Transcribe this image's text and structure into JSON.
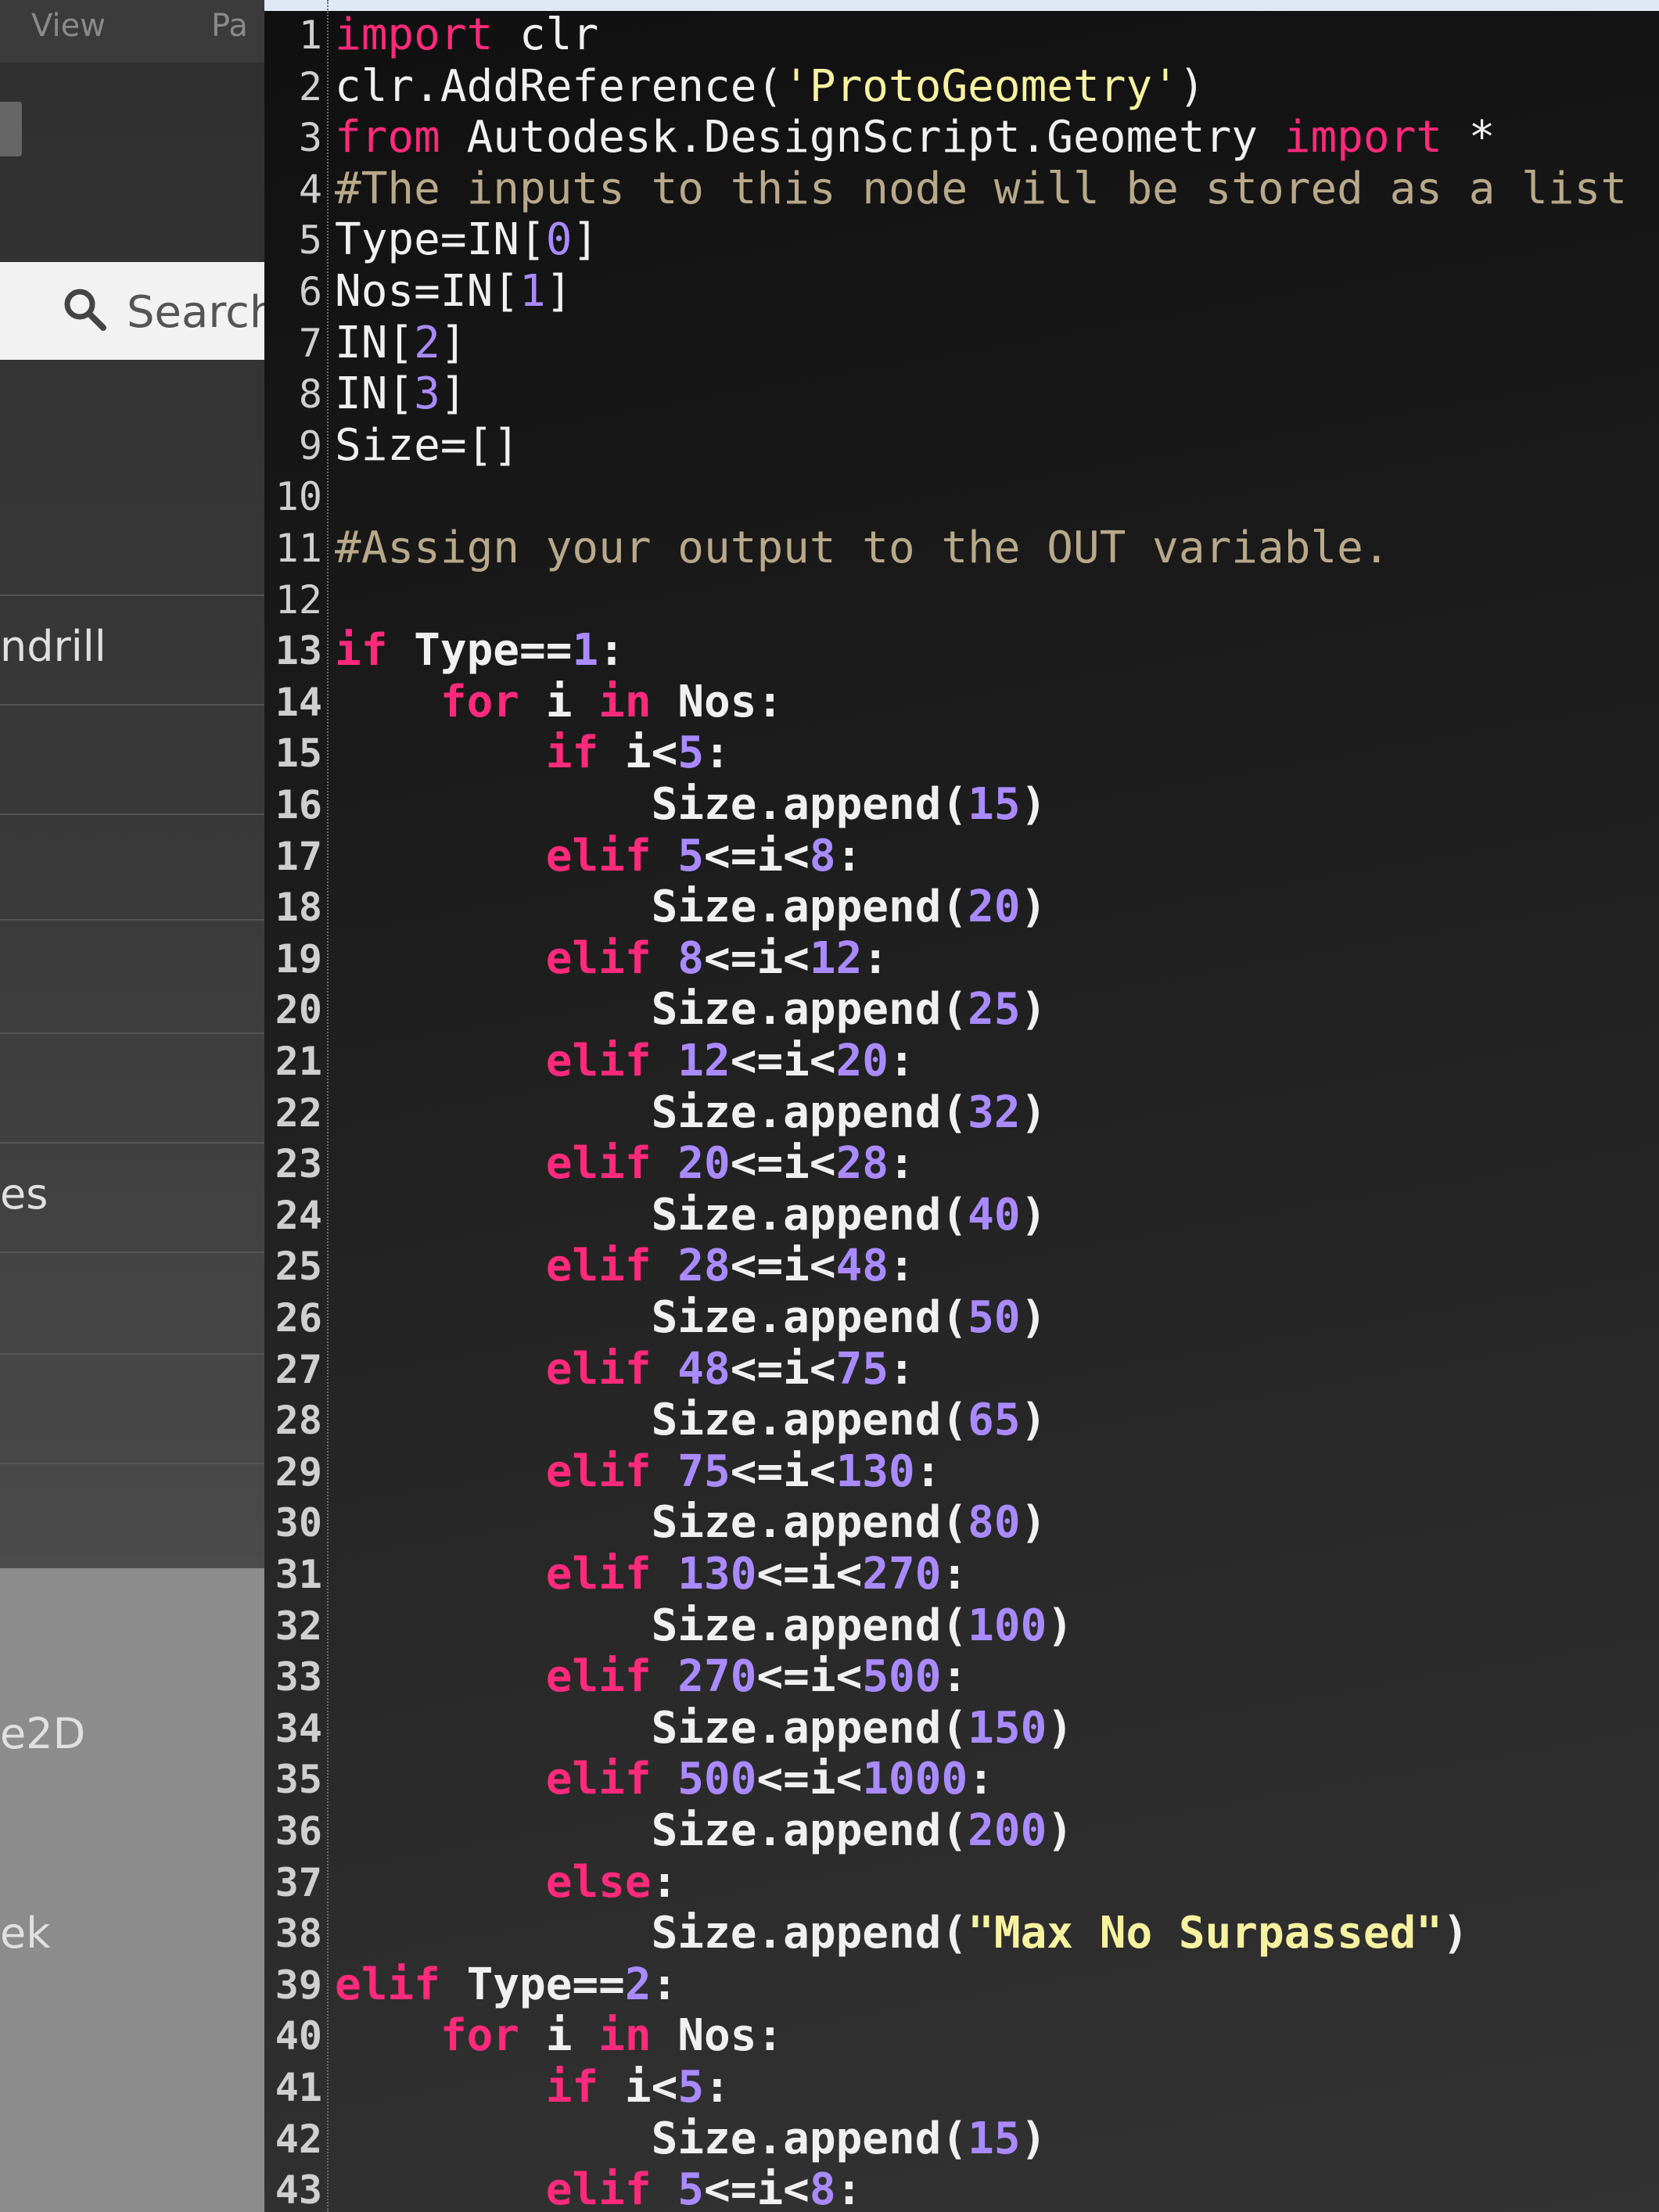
{
  "menu": {
    "view": "View",
    "partial": "Pa"
  },
  "library": {
    "search_label": "Search",
    "items": [
      "ndrill",
      "es",
      "e2D",
      "ek"
    ]
  },
  "editor": {
    "lines": [
      {
        "n": "1",
        "tokens": [
          [
            "kw",
            "import"
          ],
          [
            "op",
            " clr"
          ]
        ]
      },
      {
        "n": "2",
        "tokens": [
          [
            "op",
            "clr.AddReference("
          ],
          [
            "str",
            "'ProtoGeometry'"
          ],
          [
            "op",
            ")"
          ]
        ]
      },
      {
        "n": "3",
        "tokens": [
          [
            "kw",
            "from"
          ],
          [
            "op",
            " Autodesk.DesignScript.Geometry "
          ],
          [
            "kw",
            "import"
          ],
          [
            "op",
            " *"
          ]
        ]
      },
      {
        "n": "4",
        "tokens": [
          [
            "cmt",
            "#The inputs to this node will be stored as a list"
          ]
        ]
      },
      {
        "n": "5",
        "tokens": [
          [
            "op",
            "Type=IN["
          ],
          [
            "num",
            "0"
          ],
          [
            "op",
            "]"
          ]
        ]
      },
      {
        "n": "6",
        "tokens": [
          [
            "op",
            "Nos=IN["
          ],
          [
            "num",
            "1"
          ],
          [
            "op",
            "]"
          ]
        ]
      },
      {
        "n": "7",
        "tokens": [
          [
            "op",
            "IN["
          ],
          [
            "num",
            "2"
          ],
          [
            "op",
            "]"
          ]
        ]
      },
      {
        "n": "8",
        "tokens": [
          [
            "op",
            "IN["
          ],
          [
            "num",
            "3"
          ],
          [
            "op",
            "]"
          ]
        ]
      },
      {
        "n": "9",
        "tokens": [
          [
            "op",
            "Size=[]"
          ]
        ]
      },
      {
        "n": "10",
        "tokens": []
      },
      {
        "n": "11",
        "tokens": [
          [
            "cmt",
            "#Assign your output to the OUT variable."
          ]
        ]
      },
      {
        "n": "12",
        "tokens": []
      },
      {
        "n": "13",
        "tokens": [
          [
            "kw",
            "if"
          ],
          [
            "op",
            " Type=="
          ],
          [
            "num",
            "1"
          ],
          [
            "op",
            ":"
          ]
        ]
      },
      {
        "n": "14",
        "tokens": [
          [
            "op",
            "    "
          ],
          [
            "kw",
            "for"
          ],
          [
            "op",
            " i "
          ],
          [
            "kw",
            "in"
          ],
          [
            "op",
            " Nos:"
          ]
        ]
      },
      {
        "n": "15",
        "tokens": [
          [
            "op",
            "        "
          ],
          [
            "kw",
            "if"
          ],
          [
            "op",
            " i<"
          ],
          [
            "num",
            "5"
          ],
          [
            "op",
            ":"
          ]
        ]
      },
      {
        "n": "16",
        "tokens": [
          [
            "op",
            "            Size.append("
          ],
          [
            "num",
            "15"
          ],
          [
            "op",
            ")"
          ]
        ]
      },
      {
        "n": "17",
        "tokens": [
          [
            "op",
            "        "
          ],
          [
            "kw",
            "elif"
          ],
          [
            "op",
            " "
          ],
          [
            "num",
            "5"
          ],
          [
            "op",
            "<=i<"
          ],
          [
            "num",
            "8"
          ],
          [
            "op",
            ":"
          ]
        ]
      },
      {
        "n": "18",
        "tokens": [
          [
            "op",
            "            Size.append("
          ],
          [
            "num",
            "20"
          ],
          [
            "op",
            ")"
          ]
        ]
      },
      {
        "n": "19",
        "tokens": [
          [
            "op",
            "        "
          ],
          [
            "kw",
            "elif"
          ],
          [
            "op",
            " "
          ],
          [
            "num",
            "8"
          ],
          [
            "op",
            "<=i<"
          ],
          [
            "num",
            "12"
          ],
          [
            "op",
            ":"
          ]
        ]
      },
      {
        "n": "20",
        "tokens": [
          [
            "op",
            "            Size.append("
          ],
          [
            "num",
            "25"
          ],
          [
            "op",
            ")"
          ]
        ]
      },
      {
        "n": "21",
        "tokens": [
          [
            "op",
            "        "
          ],
          [
            "kw",
            "elif"
          ],
          [
            "op",
            " "
          ],
          [
            "num",
            "12"
          ],
          [
            "op",
            "<=i<"
          ],
          [
            "num",
            "20"
          ],
          [
            "op",
            ":"
          ]
        ]
      },
      {
        "n": "22",
        "tokens": [
          [
            "op",
            "            Size.append("
          ],
          [
            "num",
            "32"
          ],
          [
            "op",
            ")"
          ]
        ]
      },
      {
        "n": "23",
        "tokens": [
          [
            "op",
            "        "
          ],
          [
            "kw",
            "elif"
          ],
          [
            "op",
            " "
          ],
          [
            "num",
            "20"
          ],
          [
            "op",
            "<=i<"
          ],
          [
            "num",
            "28"
          ],
          [
            "op",
            ":"
          ]
        ]
      },
      {
        "n": "24",
        "tokens": [
          [
            "op",
            "            Size.append("
          ],
          [
            "num",
            "40"
          ],
          [
            "op",
            ")"
          ]
        ]
      },
      {
        "n": "25",
        "tokens": [
          [
            "op",
            "        "
          ],
          [
            "kw",
            "elif"
          ],
          [
            "op",
            " "
          ],
          [
            "num",
            "28"
          ],
          [
            "op",
            "<=i<"
          ],
          [
            "num",
            "48"
          ],
          [
            "op",
            ":"
          ]
        ]
      },
      {
        "n": "26",
        "tokens": [
          [
            "op",
            "            Size.append("
          ],
          [
            "num",
            "50"
          ],
          [
            "op",
            ")"
          ]
        ]
      },
      {
        "n": "27",
        "tokens": [
          [
            "op",
            "        "
          ],
          [
            "kw",
            "elif"
          ],
          [
            "op",
            " "
          ],
          [
            "num",
            "48"
          ],
          [
            "op",
            "<=i<"
          ],
          [
            "num",
            "75"
          ],
          [
            "op",
            ":"
          ]
        ]
      },
      {
        "n": "28",
        "tokens": [
          [
            "op",
            "            Size.append("
          ],
          [
            "num",
            "65"
          ],
          [
            "op",
            ")"
          ]
        ]
      },
      {
        "n": "29",
        "tokens": [
          [
            "op",
            "        "
          ],
          [
            "kw",
            "elif"
          ],
          [
            "op",
            " "
          ],
          [
            "num",
            "75"
          ],
          [
            "op",
            "<=i<"
          ],
          [
            "num",
            "130"
          ],
          [
            "op",
            ":"
          ]
        ]
      },
      {
        "n": "30",
        "tokens": [
          [
            "op",
            "            Size.append("
          ],
          [
            "num",
            "80"
          ],
          [
            "op",
            ")"
          ]
        ]
      },
      {
        "n": "31",
        "tokens": [
          [
            "op",
            "        "
          ],
          [
            "kw",
            "elif"
          ],
          [
            "op",
            " "
          ],
          [
            "num",
            "130"
          ],
          [
            "op",
            "<=i<"
          ],
          [
            "num",
            "270"
          ],
          [
            "op",
            ":"
          ]
        ]
      },
      {
        "n": "32",
        "tokens": [
          [
            "op",
            "            Size.append("
          ],
          [
            "num",
            "100"
          ],
          [
            "op",
            ")"
          ]
        ]
      },
      {
        "n": "33",
        "tokens": [
          [
            "op",
            "        "
          ],
          [
            "kw",
            "elif"
          ],
          [
            "op",
            " "
          ],
          [
            "num",
            "270"
          ],
          [
            "op",
            "<=i<"
          ],
          [
            "num",
            "500"
          ],
          [
            "op",
            ":"
          ]
        ]
      },
      {
        "n": "34",
        "tokens": [
          [
            "op",
            "            Size.append("
          ],
          [
            "num",
            "150"
          ],
          [
            "op",
            ")"
          ]
        ]
      },
      {
        "n": "35",
        "tokens": [
          [
            "op",
            "        "
          ],
          [
            "kw",
            "elif"
          ],
          [
            "op",
            " "
          ],
          [
            "num",
            "500"
          ],
          [
            "op",
            "<=i<"
          ],
          [
            "num",
            "1000"
          ],
          [
            "op",
            ":"
          ]
        ]
      },
      {
        "n": "36",
        "tokens": [
          [
            "op",
            "            Size.append("
          ],
          [
            "num",
            "200"
          ],
          [
            "op",
            ")"
          ]
        ]
      },
      {
        "n": "37",
        "tokens": [
          [
            "op",
            "        "
          ],
          [
            "kw",
            "else"
          ],
          [
            "op",
            ":"
          ]
        ]
      },
      {
        "n": "38",
        "tokens": [
          [
            "op",
            "            Size.append("
          ],
          [
            "str",
            "\"Max No Surpassed\""
          ],
          [
            "op",
            ")"
          ]
        ]
      },
      {
        "n": "39",
        "tokens": [
          [
            "kw",
            "elif"
          ],
          [
            "op",
            " Type=="
          ],
          [
            "num",
            "2"
          ],
          [
            "op",
            ":"
          ]
        ]
      },
      {
        "n": "40",
        "tokens": [
          [
            "op",
            "    "
          ],
          [
            "kw",
            "for"
          ],
          [
            "op",
            " i "
          ],
          [
            "kw",
            "in"
          ],
          [
            "op",
            " Nos:"
          ]
        ]
      },
      {
        "n": "41",
        "tokens": [
          [
            "op",
            "        "
          ],
          [
            "kw",
            "if"
          ],
          [
            "op",
            " i<"
          ],
          [
            "num",
            "5"
          ],
          [
            "op",
            ":"
          ]
        ]
      },
      {
        "n": "42",
        "tokens": [
          [
            "op",
            "            Size.append("
          ],
          [
            "num",
            "15"
          ],
          [
            "op",
            ")"
          ]
        ]
      },
      {
        "n": "43",
        "tokens": [
          [
            "op",
            "        "
          ],
          [
            "kw",
            "elif"
          ],
          [
            "op",
            " "
          ],
          [
            "num",
            "5"
          ],
          [
            "op",
            "<=i<"
          ],
          [
            "num",
            "8"
          ],
          [
            "op",
            ":"
          ]
        ]
      }
    ]
  }
}
